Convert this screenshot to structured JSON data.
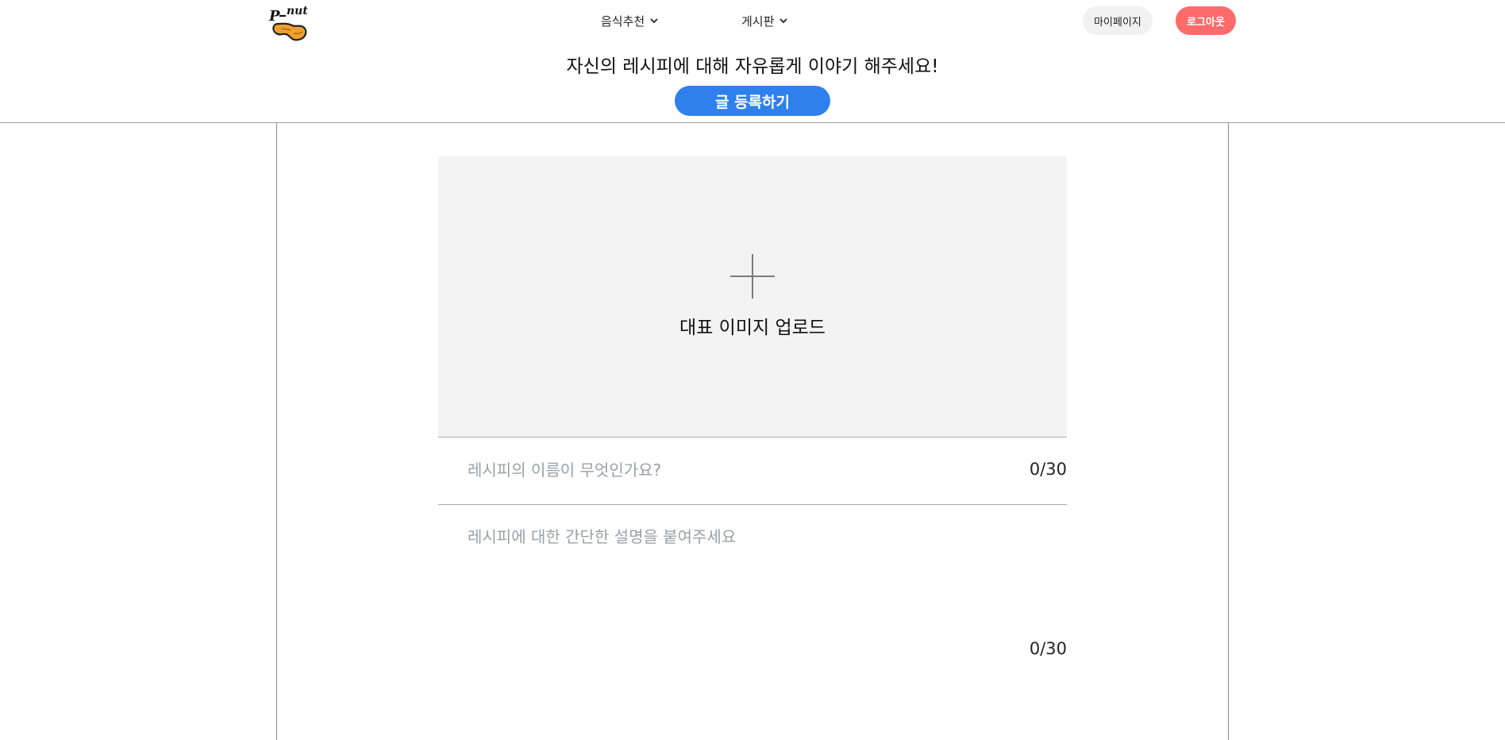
{
  "header": {
    "logo_text": "P-nut",
    "nav": [
      {
        "label": "음식추천",
        "icon": "chevron-down-icon"
      },
      {
        "label": "게시판",
        "icon": "chevron-down-icon"
      }
    ],
    "mypage_label": "마이페이지",
    "logout_label": "로그아웃"
  },
  "banner": {
    "text": "자신의 레시피에 대해 자유롭게 이야기 해주세요!",
    "post_button_label": "글 등록하기"
  },
  "form": {
    "upload": {
      "icon": "plus-icon",
      "label": "대표 이미지 업로드"
    },
    "title": {
      "placeholder": "레시피의 이름이 무엇인가요?",
      "value": "",
      "counter": "0/30"
    },
    "description": {
      "placeholder": "레시피에 대한 간단한 설명을 붙여주세요",
      "value": "",
      "counter": "0/30"
    }
  },
  "colors": {
    "logout_bg": "#ff6b6b",
    "post_button_bg": "#2f80ed",
    "mypage_bg": "#f1f1f1",
    "upload_bg": "#f3f3f3",
    "logo_orange": "#f0a030"
  }
}
